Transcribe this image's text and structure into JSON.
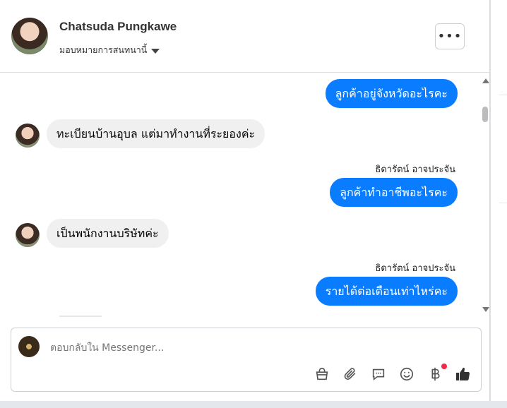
{
  "header": {
    "name": "Chatsuda Pungkawe",
    "assign_label": "มอบหมายการสนทนานี้",
    "more_label": "•••"
  },
  "messages": [
    {
      "dir": "out",
      "text": "ลูกค้าอยู่จังหวัดอะไรคะ"
    },
    {
      "dir": "in",
      "text": "ทะเบียนบ้านอุบล แต่มาทำงานที่ระยองค่ะ"
    },
    {
      "dir": "out",
      "sender": "ธิดารัตน์ อาจประจัน",
      "text": "ลูกค้าทำอาชีพอะไรคะ"
    },
    {
      "dir": "in",
      "text": "เป็นพนักงานบริษัทค่ะ"
    },
    {
      "dir": "out",
      "sender": "ธิดารัตน์ อาจประจัน",
      "text": "รายได้ต่อเดือนเท่าไหร่คะ"
    }
  ],
  "composer": {
    "placeholder": "ตอบกลับใน Messenger...",
    "tools": [
      "shop-icon",
      "attach-icon",
      "saved-reply-icon",
      "emoji-icon",
      "baht-payment-icon",
      "like-icon"
    ]
  },
  "colors": {
    "outgoing_bubble": "#0a7cff",
    "incoming_bubble": "#f0f0f0",
    "notification_dot": "#f02849"
  }
}
